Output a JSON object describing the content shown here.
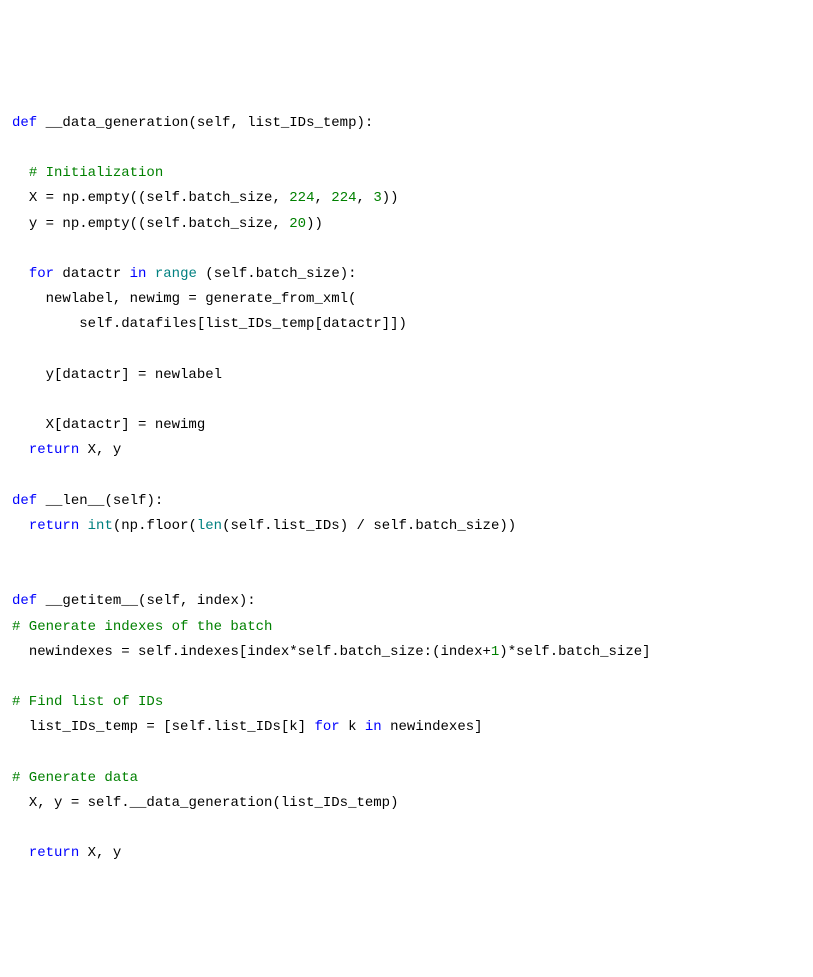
{
  "code": {
    "l1_def": "def",
    "l1_name": "__data_generation",
    "l1_rest": "(self, list_IDs_temp):",
    "l3_cmt": "# Initialization",
    "l4_a": "X = np.empty((self.batch_size, ",
    "l4_n1": "224",
    "l4_c1": ", ",
    "l4_n2": "224",
    "l4_c2": ", ",
    "l4_n3": "3",
    "l4_e": "))",
    "l5_a": "y = np.empty((self.batch_size, ",
    "l5_n1": "20",
    "l5_e": "))",
    "l7_for": "for",
    "l7_mid": " datactr ",
    "l7_in": "in",
    "l7_sp": " ",
    "l7_range": "range",
    "l7_rest": " (self.batch_size):",
    "l8": "newlabel, newimg = generate_from_xml(",
    "l9": "self.datafiles[list_IDs_temp[datactr]])",
    "l11": "y[datactr] = newlabel",
    "l13": "X[datactr] = newimg",
    "l14_ret": "return",
    "l14_rest": " X, y",
    "l16_def": "def",
    "l16_name": "__len__",
    "l16_rest": "(self):",
    "l17_ret": "return",
    "l17_sp": " ",
    "l17_int": "int",
    "l17_a": "(np.floor(",
    "l17_len": "len",
    "l17_b": "(self.list_IDs) / self.batch_size))",
    "l20_def": "def",
    "l20_name": "__getitem__",
    "l20_rest": "(self, index):",
    "l21_cmt": "# Generate indexes of the batch",
    "l22_a": "newindexes = self.indexes[index*self.batch_size:(index+",
    "l22_n": "1",
    "l22_b": ")*self.batch_size]",
    "l24_cmt": "# Find list of IDs",
    "l25_a": "list_IDs_temp = [self.list_IDs[k] ",
    "l25_for": "for",
    "l25_mid": " k ",
    "l25_in": "in",
    "l25_b": " newindexes]",
    "l27_cmt": "# Generate data",
    "l28": "X, y = self.__data_generation(list_IDs_temp)",
    "l30_ret": "return",
    "l30_rest": " X, y"
  }
}
